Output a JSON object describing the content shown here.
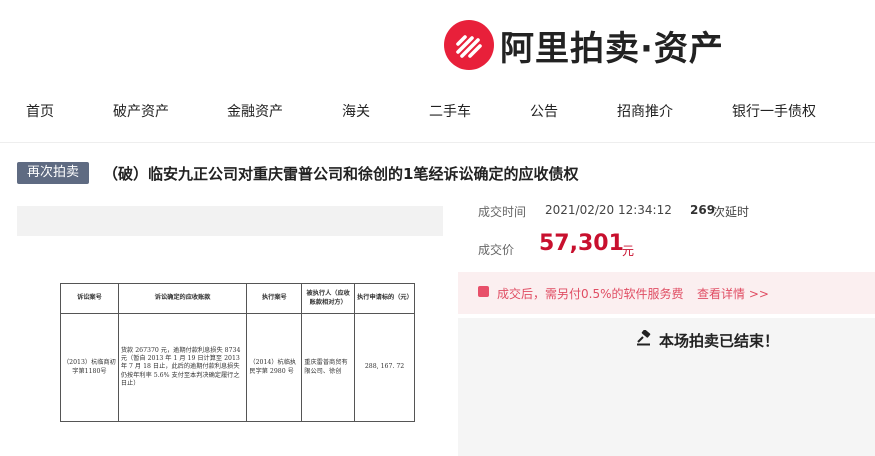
{
  "brand": {
    "logo_text": "阿里拍卖·资产",
    "color": "#e8203a"
  },
  "nav": {
    "items": [
      {
        "label": "首页"
      },
      {
        "label": "破产资产"
      },
      {
        "label": "金融资产"
      },
      {
        "label": "海关"
      },
      {
        "label": "二手车"
      },
      {
        "label": "公告"
      },
      {
        "label": "招商推介"
      },
      {
        "label": "银行一手债权"
      }
    ]
  },
  "item": {
    "badge": "再次拍卖",
    "title": "（破）临安九正公司对重庆雷普公司和徐创的1笔经诉讼确定的应收债权"
  },
  "document": {
    "headers": [
      "诉讼案号",
      "诉讼确定的应收账款",
      "执行案号",
      "被执行人（应收账款相对方）",
      "执行申请标的（元）"
    ],
    "row": [
      "（2013）杭临商初字第1180号",
      "货款 267370 元，逾期付款利息损失 8734 元（暂自 2013 年 1 月 19 日计算至 2013 年 7 月 18 日止，此后的逾期付款利息损失仍按年利率 5.6% 支付至本判决确定履行之日止）",
      "（2014）杭临执民字第 2980 号",
      "重庆雷普商贸有限公司、徐创",
      "288, 167. 72"
    ]
  },
  "auction": {
    "deal_time_label": "成交时间",
    "deal_time": "2021/02/20 12:34:12",
    "delay_count": "269",
    "delay_suffix": "次延时",
    "price_label": "成交价",
    "price": "57,301",
    "price_unit": "元",
    "fee_text": "成交后，需另付0.5%的软件服务费",
    "fee_link": "查看详情 >>",
    "ended_text": "本场拍卖已结束！"
  }
}
